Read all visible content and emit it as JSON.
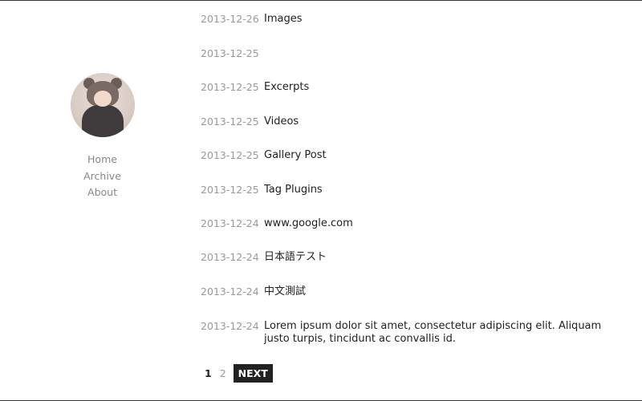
{
  "sidebar": {
    "nav": [
      {
        "label": "Home"
      },
      {
        "label": "Archive"
      },
      {
        "label": "About"
      }
    ]
  },
  "posts": [
    {
      "date": "2013-12-26",
      "title": "Images"
    },
    {
      "date": "2013-12-25",
      "title": ""
    },
    {
      "date": "2013-12-25",
      "title": "Excerpts"
    },
    {
      "date": "2013-12-25",
      "title": "Videos"
    },
    {
      "date": "2013-12-25",
      "title": "Gallery Post"
    },
    {
      "date": "2013-12-25",
      "title": "Tag Plugins"
    },
    {
      "date": "2013-12-24",
      "title": "www.google.com"
    },
    {
      "date": "2013-12-24",
      "title": "日本語テスト"
    },
    {
      "date": "2013-12-24",
      "title": "中文測試"
    },
    {
      "date": "2013-12-24",
      "title": "Lorem ipsum dolor sit amet, consectetur adipiscing elit. Aliquam justo turpis, tincidunt ac convallis id."
    }
  ],
  "pagination": {
    "current": "1",
    "page2": "2",
    "next_label": "NEXT"
  }
}
